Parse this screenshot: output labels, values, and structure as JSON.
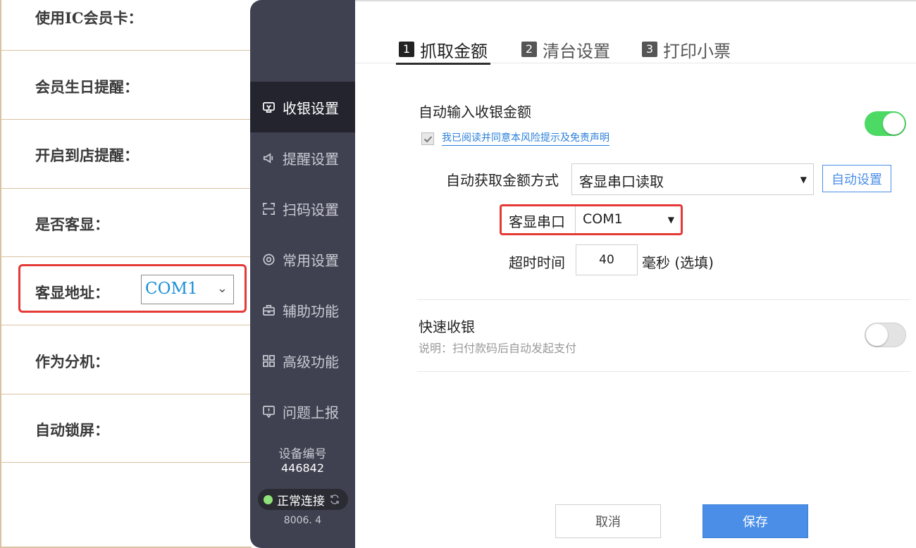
{
  "left_panel": {
    "rows": [
      {
        "label": "使用IC会员卡："
      },
      {
        "label": "会员生日提醒："
      },
      {
        "label": "开启到店提醒："
      },
      {
        "label": "是否客显："
      },
      {
        "label": "客显地址："
      },
      {
        "label": "作为分机："
      },
      {
        "label": "自动锁屏："
      }
    ],
    "display_address_value": "COM1"
  },
  "sidebar": {
    "items": [
      {
        "label": "收银设置",
        "icon": "cashier-icon",
        "active": true
      },
      {
        "label": "提醒设置",
        "icon": "speaker-icon",
        "active": false
      },
      {
        "label": "扫码设置",
        "icon": "scan-icon",
        "active": false
      },
      {
        "label": "常用设置",
        "icon": "gear-icon",
        "active": false
      },
      {
        "label": "辅助功能",
        "icon": "toolbox-icon",
        "active": false
      },
      {
        "label": "高级功能",
        "icon": "grid-icon",
        "active": false
      },
      {
        "label": "问题上报",
        "icon": "report-icon",
        "active": false
      }
    ],
    "device_label": "设备编号",
    "device_number": "446842",
    "connection_status": "正常连接",
    "version": "8006. 4"
  },
  "tabs": [
    {
      "num": "1",
      "label": "抓取金额",
      "active": true
    },
    {
      "num": "2",
      "label": "清台设置",
      "active": false
    },
    {
      "num": "3",
      "label": "打印小票",
      "active": false
    }
  ],
  "auto_amount": {
    "title": "自动输入收银金额",
    "agreement_text": "我已阅读并同意本风险提示及免责声明",
    "agreement_checked": true,
    "enabled": true,
    "method_label": "自动获取金额方式",
    "method_value": "客显串口读取",
    "auto_setting_label": "自动设置",
    "port_label": "客显串口",
    "port_value": "COM1",
    "timeout_label": "超时时间",
    "timeout_value": "40",
    "timeout_unit": "毫秒 (选填)"
  },
  "quick_checkout": {
    "title": "快速收银",
    "description": "说明：扫付款码后自动发起支付",
    "enabled": false
  },
  "footer": {
    "cancel_label": "取消",
    "save_label": "保存"
  },
  "colors": {
    "sidebar_bg": "#3f4150",
    "sidebar_active": "#23242d",
    "accent_blue": "#4a8ee8",
    "toggle_on": "#4cd964",
    "highlight_red": "#e53935"
  }
}
